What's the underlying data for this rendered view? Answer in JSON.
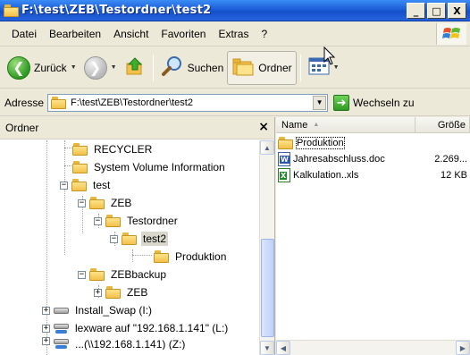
{
  "window": {
    "title": "F:\\test\\ZEB\\Testordner\\test2",
    "minimize_glyph": "_",
    "maximize_glyph": "□",
    "close_glyph": "X"
  },
  "menu": {
    "items": [
      "Datei",
      "Bearbeiten",
      "Ansicht",
      "Favoriten",
      "Extras",
      "?"
    ]
  },
  "toolbar": {
    "back_label": "Zurück",
    "search_label": "Suchen",
    "folders_label": "Ordner"
  },
  "address": {
    "label": "Adresse",
    "path": "F:\\test\\ZEB\\Testordner\\test2",
    "go_label": "Wechseln zu"
  },
  "folder_pane": {
    "header": "Ordner",
    "close_glyph": "×",
    "tree": [
      {
        "label": "RECYCLER",
        "icon": "folder"
      },
      {
        "label": "System Volume Information",
        "icon": "folder"
      },
      {
        "label": "test",
        "icon": "folder",
        "expander": "−"
      },
      {
        "label": "ZEB",
        "icon": "folder",
        "expander": "−"
      },
      {
        "label": "Testordner",
        "icon": "folder",
        "expander": "−"
      },
      {
        "label": "test2",
        "icon": "folder",
        "expander": "−",
        "selected": true
      },
      {
        "label": "Produktion",
        "icon": "folder"
      },
      {
        "label": "ZEBbackup",
        "icon": "folder",
        "expander": "−"
      },
      {
        "label": "ZEB",
        "icon": "folder",
        "expander": "+"
      },
      {
        "label": "Install_Swap (I:)",
        "icon": "drive",
        "expander": "+"
      },
      {
        "label": "lexware auf \"192.168.1.141\" (L:)",
        "icon": "network-drive",
        "expander": "+"
      },
      {
        "label": "...(\\\\192.168.1.141) (Z:)",
        "icon": "network-drive",
        "expander": "+"
      }
    ]
  },
  "file_list": {
    "columns": {
      "name": "Name",
      "size": "Größe"
    },
    "files": [
      {
        "name": "Produktion",
        "size": "",
        "icon": "folder"
      },
      {
        "name": "Jahresabschluss.doc",
        "size": "2.269...",
        "icon": "word-doc"
      },
      {
        "name": "Kalkulation..xls",
        "size": "12 KB",
        "icon": "excel-xls"
      }
    ]
  },
  "colors": {
    "title_bar": "#1d5fd8",
    "chrome": "#ece9d8",
    "selection": "#d9d7cc"
  }
}
